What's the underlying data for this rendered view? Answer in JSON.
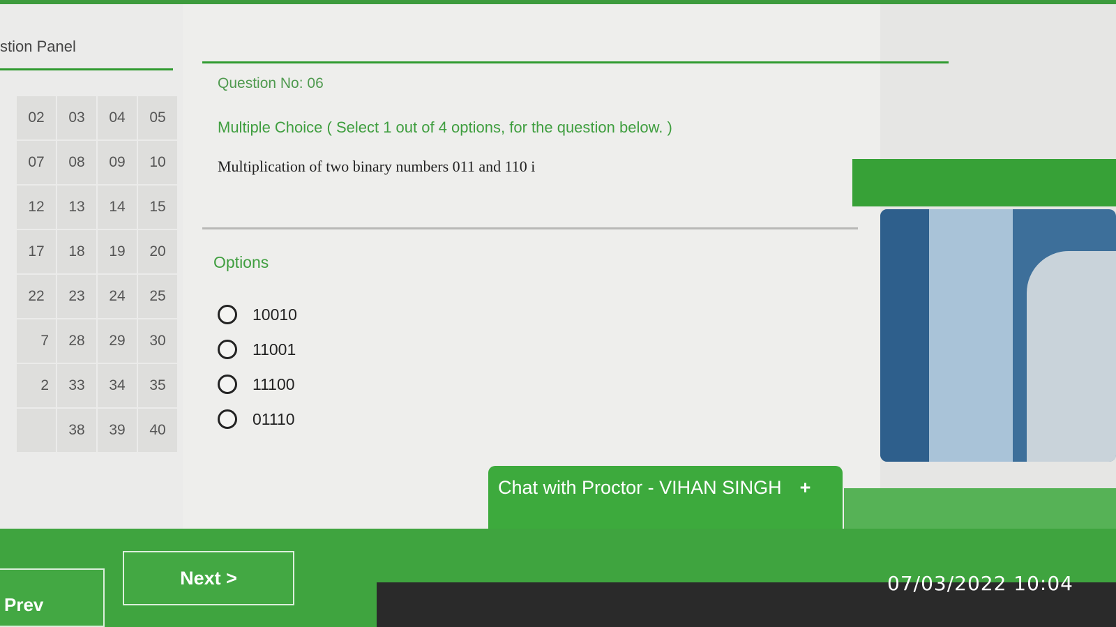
{
  "left_panel": {
    "title": "stion Panel",
    "question_numbers": [
      [
        "02",
        "03",
        "04",
        "05"
      ],
      [
        "07",
        "08",
        "09",
        "10"
      ],
      [
        "12",
        "13",
        "14",
        "15"
      ],
      [
        "17",
        "18",
        "19",
        "20"
      ],
      [
        "22",
        "23",
        "24",
        "25"
      ],
      [
        "7",
        "28",
        "29",
        "30"
      ],
      [
        "2",
        "33",
        "34",
        "35"
      ],
      [
        "38",
        "39",
        "40"
      ]
    ]
  },
  "question": {
    "number_label": "Question No: 06",
    "type_label": "Multiple Choice ( Select 1 out of 4 options, for the question below. )",
    "text": "Multiplication of two binary numbers 011 and 110 i"
  },
  "options": {
    "title": "Options",
    "items": [
      "10010",
      "11001",
      "11100",
      "01110"
    ]
  },
  "chat": {
    "label": "Chat with Proctor - VIHAN SINGH",
    "plus": "+"
  },
  "nav": {
    "prev_label": "Prev",
    "next_label": "Next >"
  },
  "photo_timestamp": "07/03/2022 10:04",
  "colors": {
    "accent_green": "#3daa3d",
    "option_title_green": "#3f9e3f"
  }
}
